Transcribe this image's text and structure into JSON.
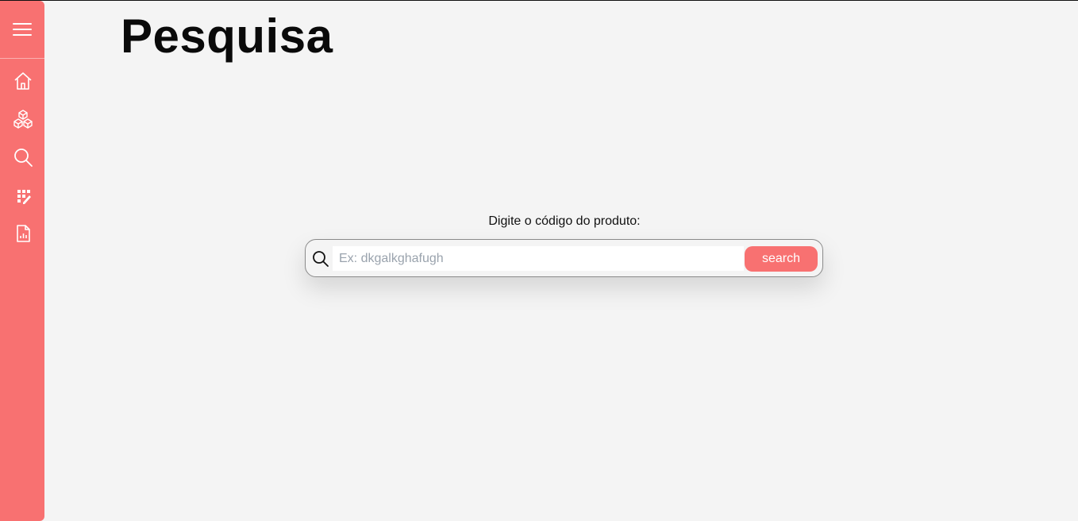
{
  "colors": {
    "accent": "#f87171",
    "background": "#f4f4f4",
    "title": "#0a0a0a"
  },
  "sidebar": {
    "menu_icon": "hamburger-menu-icon",
    "items": [
      {
        "icon": "home-icon"
      },
      {
        "icon": "cubes-icon"
      },
      {
        "icon": "search-icon"
      },
      {
        "icon": "grid-edit-icon"
      },
      {
        "icon": "report-icon"
      }
    ]
  },
  "main": {
    "title": "Pesquisa",
    "search": {
      "label": "Digite o código do produto:",
      "placeholder": "Ex: dkgalkghafugh",
      "value": "",
      "button_label": "search"
    }
  }
}
